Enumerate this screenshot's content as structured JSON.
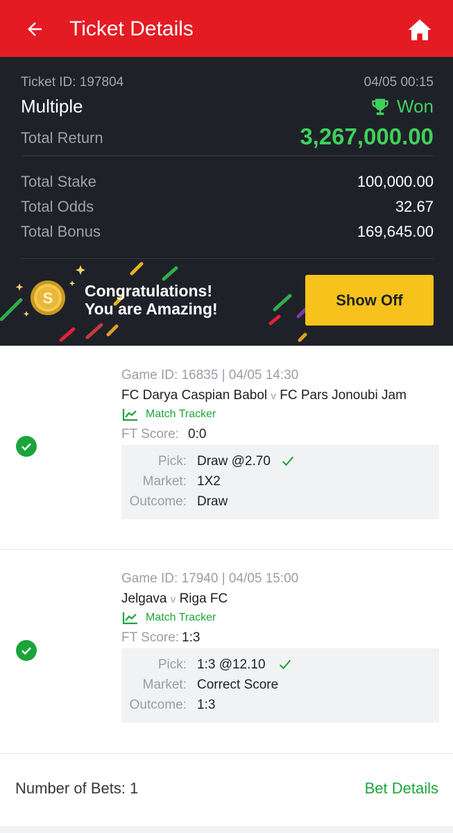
{
  "header": {
    "title": "Ticket Details"
  },
  "ticket": {
    "id_text": "Ticket ID: 197804",
    "datetime": "04/05 00:15",
    "type": "Multiple",
    "status": "Won",
    "total_return_label": "Total Return",
    "total_return": "3,267,000.00",
    "total_stake_label": "Total Stake",
    "total_stake": "100,000.00",
    "total_odds_label": "Total Odds",
    "total_odds": "32.67",
    "total_bonus_label": "Total Bonus",
    "total_bonus": "169,645.00"
  },
  "promo": {
    "line1": "Congratulations!",
    "line2": "You are Amazing!",
    "button_label": "Show Off"
  },
  "bets": [
    {
      "game_info": "Game ID: 16835 | 04/05 14:30",
      "home": "FC Darya Caspian Babol",
      "vs": "v",
      "away": "FC Pars Jonoubi Jam",
      "tracker_label": "Match Tracker",
      "ft_label": "FT Score:",
      "ft_score": "0:0",
      "pick_label": "Pick:",
      "pick": "Draw @2.70",
      "market_label": "Market:",
      "market": "1X2",
      "outcome_label": "Outcome:",
      "outcome": "Draw"
    },
    {
      "game_info": "Game ID: 17940 | 04/05 15:00",
      "home": "Jelgava",
      "vs": "v",
      "away": "Riga FC",
      "tracker_label": "Match Tracker",
      "ft_label": "FT Score:",
      "ft_score": "1:3",
      "pick_label": "Pick:",
      "pick": "1:3 @12.10",
      "market_label": "Market:",
      "market": "Correct Score",
      "outcome_label": "Outcome:",
      "outcome": "1:3"
    }
  ],
  "footer": {
    "number_of_bets": "Number of Bets: 1",
    "bet_details_label": "Bet Details"
  },
  "colors": {
    "header_red": "#e41b23",
    "dark_panel": "#1f2129",
    "won_green": "#3fd05c",
    "success_green": "#1ba43a",
    "button_yellow": "#f7c21b"
  },
  "icons": [
    "back-arrow-icon",
    "home-icon",
    "trophy-icon",
    "coin-icon",
    "check-circle-icon",
    "chart-line-icon",
    "checkmark-icon"
  ]
}
